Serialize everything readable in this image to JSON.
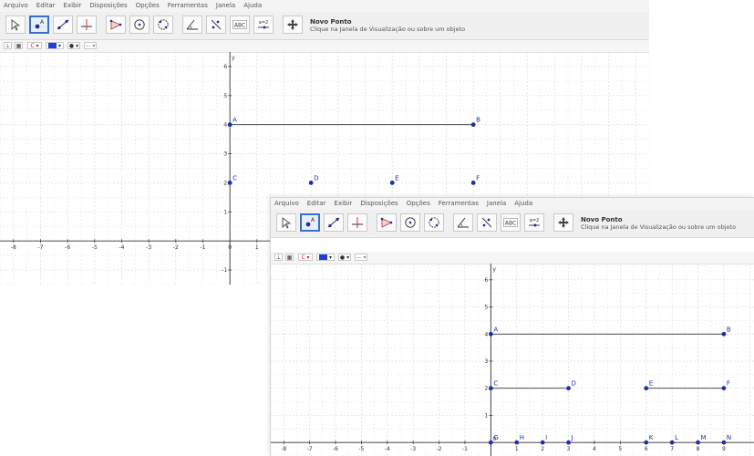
{
  "menu": [
    "Arquivo",
    "Editar",
    "Exibir",
    "Disposições",
    "Opções",
    "Ferramentas",
    "Janela",
    "Ajuda"
  ],
  "tools": [
    {
      "name": "move-tool-icon"
    },
    {
      "name": "point-tool-icon"
    },
    {
      "name": "line-tool-icon"
    },
    {
      "name": "perpendicular-tool-icon"
    },
    {
      "name": "polygon-tool-icon"
    },
    {
      "name": "circle-tool-icon"
    },
    {
      "name": "conic-tool-icon"
    },
    {
      "name": "angle-tool-icon"
    },
    {
      "name": "reflect-tool-icon"
    },
    {
      "name": "text-tool-icon",
      "label": "ABC"
    },
    {
      "name": "slider-tool-icon",
      "label": "a=2"
    },
    {
      "name": "move-view-tool-icon"
    }
  ],
  "tool_help": {
    "title": "Novo Ponto",
    "text": "Clique na Janela de Visualização ou sobre um objeto"
  },
  "stylebar": {
    "color_label": "C"
  },
  "colors": {
    "grid": "#dcdcdc",
    "axes": "#333333",
    "point": "#1f2fa8",
    "segment": "#333333",
    "active_tool": "#3a6fc8"
  },
  "window1": {
    "xlim": [
      -8.5,
      15.5
    ],
    "ylim": [
      -1.5,
      6.5
    ],
    "axis_label_y": "y",
    "x_ticks": [
      -8,
      -7,
      -6,
      -5,
      -4,
      -3,
      -2,
      -1,
      0,
      1
    ],
    "y_ticks": [
      1,
      2,
      3,
      4,
      5,
      6
    ],
    "y_tick_min": -1,
    "points": [
      {
        "name": "A",
        "x": 0,
        "y": 4
      },
      {
        "name": "B",
        "x": 9,
        "y": 4
      },
      {
        "name": "C",
        "x": 0,
        "y": 2
      },
      {
        "name": "D",
        "x": 3,
        "y": 2
      },
      {
        "name": "E",
        "x": 6,
        "y": 2
      },
      {
        "name": "F",
        "x": 9,
        "y": 2
      }
    ],
    "segments": [
      [
        "A",
        "B"
      ]
    ]
  },
  "window2": {
    "xlim": [
      -8.5,
      10.2
    ],
    "ylim": [
      -0.5,
      6.6
    ],
    "axis_label_y": "y",
    "x_ticks": [
      -8,
      -7,
      -6,
      -5,
      -4,
      -3,
      -2,
      -1,
      1,
      2,
      3,
      4,
      5,
      6,
      7,
      8,
      9
    ],
    "y_ticks": [
      1,
      2,
      3,
      4,
      5,
      6
    ],
    "origin_label": "0",
    "points": [
      {
        "name": "A",
        "x": 0,
        "y": 4
      },
      {
        "name": "B",
        "x": 9,
        "y": 4
      },
      {
        "name": "C",
        "x": 0,
        "y": 2
      },
      {
        "name": "D",
        "x": 3,
        "y": 2
      },
      {
        "name": "E",
        "x": 6,
        "y": 2
      },
      {
        "name": "F",
        "x": 9,
        "y": 2
      },
      {
        "name": "G",
        "x": 0,
        "y": 0
      },
      {
        "name": "H",
        "x": 1,
        "y": 0
      },
      {
        "name": "I",
        "x": 2,
        "y": 0
      },
      {
        "name": "J",
        "x": 3,
        "y": 0
      },
      {
        "name": "K",
        "x": 6,
        "y": 0
      },
      {
        "name": "L",
        "x": 7,
        "y": 0
      },
      {
        "name": "M",
        "x": 8,
        "y": 0
      },
      {
        "name": "N",
        "x": 9,
        "y": 0
      }
    ],
    "segments": [
      [
        "A",
        "B"
      ],
      [
        "C",
        "D"
      ],
      [
        "E",
        "F"
      ]
    ]
  }
}
